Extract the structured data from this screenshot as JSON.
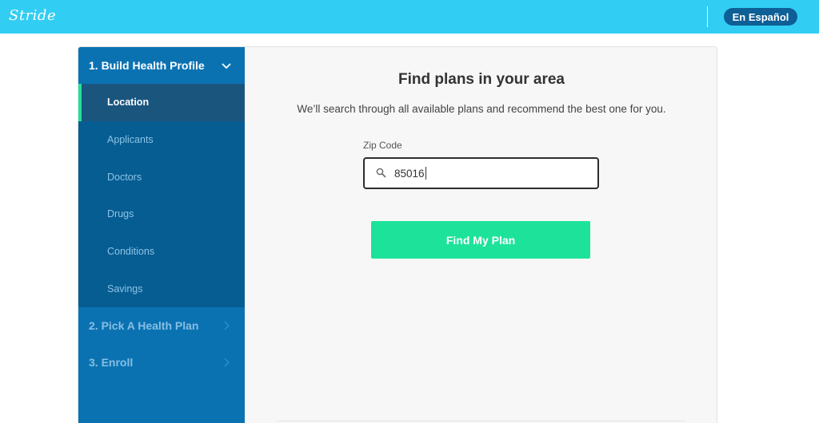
{
  "header": {
    "logo": "Stride",
    "language_button": "En Español",
    "bar_color": "#32cdf3"
  },
  "sidebar": {
    "steps": [
      {
        "label": "1. Build Health Profile",
        "expanded": true
      },
      {
        "label": "2. Pick A Health Plan",
        "expanded": false
      },
      {
        "label": "3. Enroll",
        "expanded": false
      }
    ],
    "substeps": [
      {
        "label": "Location",
        "current": true
      },
      {
        "label": "Applicants",
        "current": false
      },
      {
        "label": "Doctors",
        "current": false
      },
      {
        "label": "Drugs",
        "current": false
      },
      {
        "label": "Conditions",
        "current": false
      },
      {
        "label": "Savings",
        "current": false
      }
    ],
    "accent_color": "#22e09c"
  },
  "main": {
    "title": "Find plans in your area",
    "subtitle": "We’ll search through all available plans and recommend the best one for you.",
    "zip_label": "Zip Code",
    "zip_value": "85016",
    "zip_icon": "search-icon",
    "button_label": "Find My Plan",
    "button_color": "#1de39a"
  }
}
